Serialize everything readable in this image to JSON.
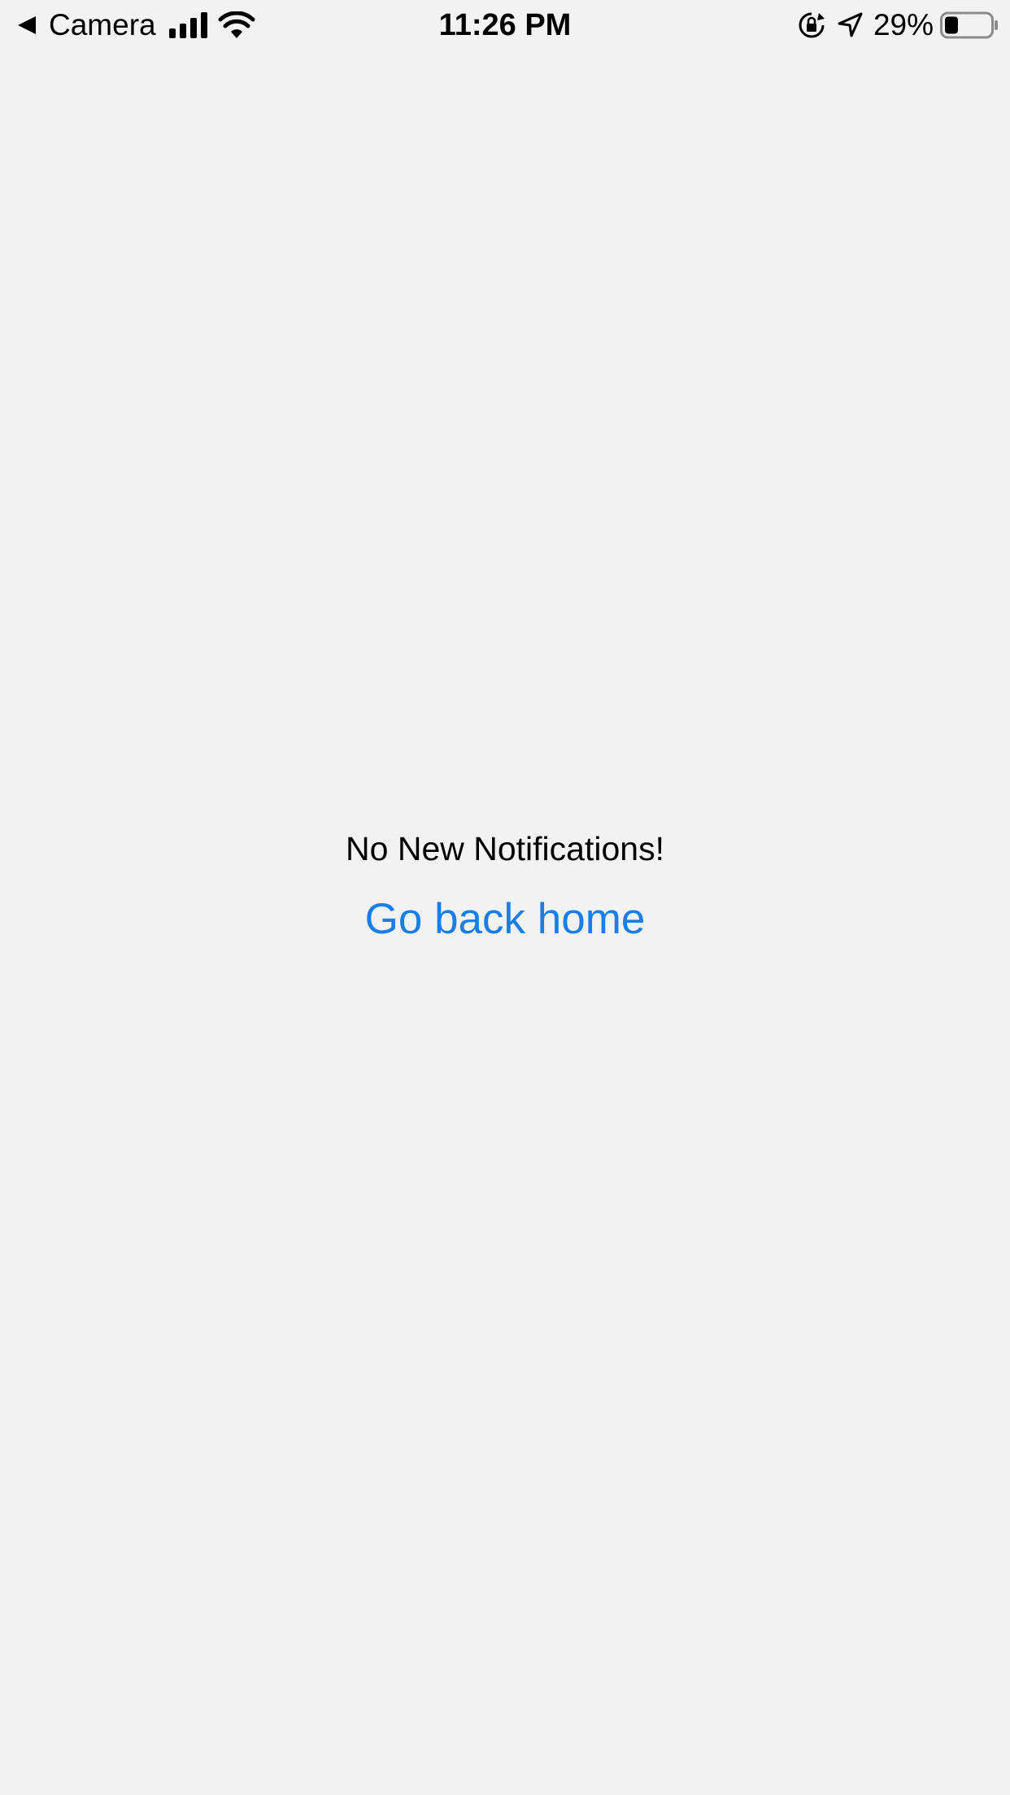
{
  "status_bar": {
    "back_label": "Camera",
    "time": "11:26 PM",
    "battery_percent": "29%",
    "icons": [
      "back-arrow-icon",
      "signal-icon",
      "wifi-icon",
      "rotation-lock-icon",
      "location-icon",
      "battery-icon"
    ],
    "battery_level": 0.29
  },
  "notifications": {
    "empty_message": "No New Notifications!",
    "home_link_label": "Go back home"
  },
  "colors": {
    "background": "#f2f2f2",
    "link": "#1a7ee8",
    "text": "#000000"
  }
}
